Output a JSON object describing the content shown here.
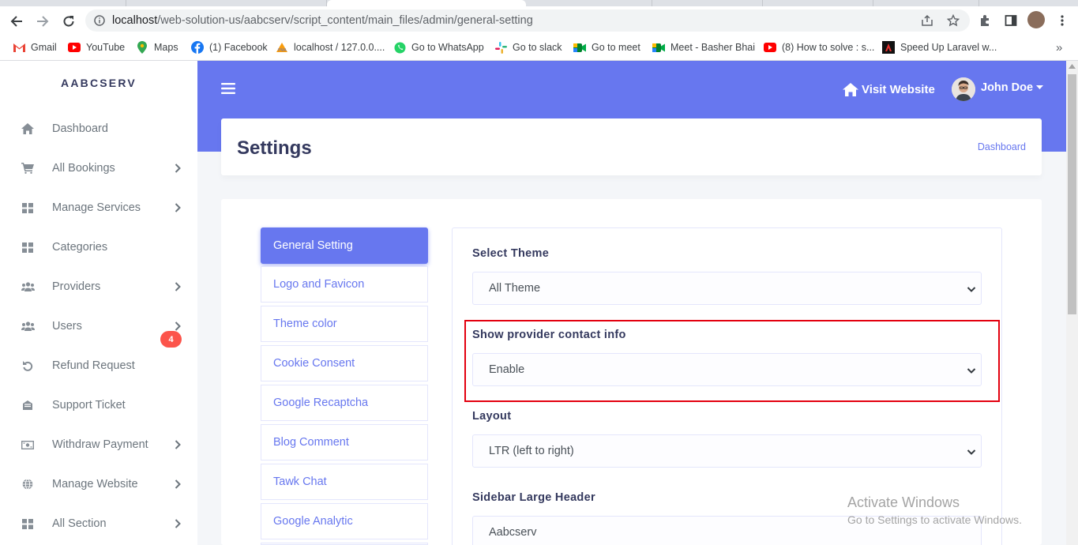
{
  "browser": {
    "url_host": "localhost",
    "url_path": "/web-solution-us/aabcserv/script_content/main_files/admin/general-setting",
    "bookmarks": [
      {
        "label": "Gmail",
        "icon": "gmail-icon"
      },
      {
        "label": "YouTube",
        "icon": "youtube-icon"
      },
      {
        "label": "Maps",
        "icon": "maps-icon"
      },
      {
        "label": "(1) Facebook",
        "icon": "facebook-icon"
      },
      {
        "label": "localhost / 127.0.0....",
        "icon": "phpmyadmin-icon"
      },
      {
        "label": "Go to WhatsApp",
        "icon": "whatsapp-icon"
      },
      {
        "label": "Go to slack",
        "icon": "slack-icon"
      },
      {
        "label": "Go to meet",
        "icon": "meet-icon"
      },
      {
        "label": "Meet - Basher Bhai",
        "icon": "meet-icon"
      },
      {
        "label": "(8) How to solve : s...",
        "icon": "youtube-icon"
      },
      {
        "label": "Speed Up Laravel w...",
        "icon": "laravel-icon"
      }
    ],
    "more": "»"
  },
  "sidebar": {
    "brand": "AABCSERV",
    "items": [
      {
        "label": "Dashboard",
        "icon": "home-icon",
        "chevron": false
      },
      {
        "label": "All Bookings",
        "icon": "cart-icon",
        "chevron": true
      },
      {
        "label": "Manage Services",
        "icon": "grid-icon",
        "chevron": true
      },
      {
        "label": "Categories",
        "icon": "grid-icon",
        "chevron": false
      },
      {
        "label": "Providers",
        "icon": "users-icon",
        "chevron": true
      },
      {
        "label": "Users",
        "icon": "users-icon",
        "chevron": true
      },
      {
        "label": "Refund Request",
        "icon": "undo-icon",
        "chevron": false
      },
      {
        "label": "Support Ticket",
        "icon": "envelope-icon",
        "chevron": false,
        "badge": "4"
      },
      {
        "label": "Withdraw Payment",
        "icon": "money-icon",
        "chevron": true
      },
      {
        "label": "Manage Website",
        "icon": "globe-icon",
        "chevron": true
      },
      {
        "label": "All Section",
        "icon": "grid-icon",
        "chevron": true
      }
    ]
  },
  "topbar": {
    "visit_label": "Visit Website",
    "user_name": "John Doe"
  },
  "header": {
    "title": "Settings",
    "breadcrumb": "Dashboard"
  },
  "tabs": [
    "General Setting",
    "Logo and Favicon",
    "Theme color",
    "Cookie Consent",
    "Google Recaptcha",
    "Blog Comment",
    "Tawk Chat",
    "Google Analytic"
  ],
  "active_tab": "General Setting",
  "form": {
    "theme_label": "Select Theme",
    "theme_value": "All Theme",
    "contact_label": "Show provider contact info",
    "contact_value": "Enable",
    "layout_label": "Layout",
    "layout_value": "LTR (left to right)",
    "sidebar_header_label": "Sidebar Large Header",
    "sidebar_header_value": "Aabcserv"
  },
  "watermark": {
    "line1": "Activate Windows",
    "line2": "Go to Settings to activate Windows."
  },
  "colors": {
    "primary": "#6777ef",
    "highlight": "#e3000f",
    "badge": "#fc544b"
  }
}
